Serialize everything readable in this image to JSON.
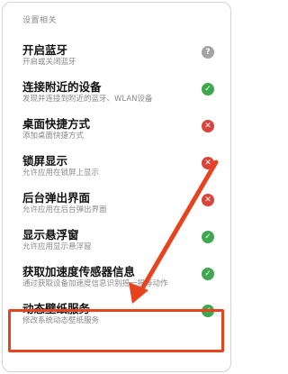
{
  "section_header": "设置相关",
  "items": [
    {
      "title": "开启蓝牙",
      "subtitle": "开启或关闭蓝牙",
      "status": "help",
      "status_icon": "question-icon",
      "status_glyph": "?"
    },
    {
      "title": "连接附近的设备",
      "subtitle": "发现并连接到附近的蓝牙、WLAN设备",
      "status": "ok",
      "status_icon": "check-icon",
      "status_glyph": "✓"
    },
    {
      "title": "桌面快捷方式",
      "subtitle": "添加桌面快捷方式",
      "status": "deny",
      "status_icon": "cross-icon",
      "status_glyph": "✕"
    },
    {
      "title": "锁屏显示",
      "subtitle": "允许应用在锁屏上显示",
      "status": "deny",
      "status_icon": "cross-icon",
      "status_glyph": "✕"
    },
    {
      "title": "后台弹出界面",
      "subtitle": "允许应用在后台弹出界面",
      "status": "deny",
      "status_icon": "cross-icon",
      "status_glyph": "✕"
    },
    {
      "title": "显示悬浮窗",
      "subtitle": "允许应用显示悬浮窗",
      "status": "ok",
      "status_icon": "check-icon",
      "status_glyph": "✓"
    },
    {
      "title": "获取加速度传感器信息",
      "subtitle": "通过获取设备加速度信息识别摇一摇等动作",
      "status": "ok",
      "status_icon": "check-icon",
      "status_glyph": "✓"
    },
    {
      "title": "动态壁纸服务",
      "subtitle": "修改系统动态壁纸服务",
      "status": "ok",
      "status_icon": "check-icon",
      "status_glyph": "✓"
    }
  ],
  "colors": {
    "ok": "#3fa74f",
    "deny": "#d9433a",
    "help": "#a3a3a3",
    "annotation": "#e8431f"
  }
}
